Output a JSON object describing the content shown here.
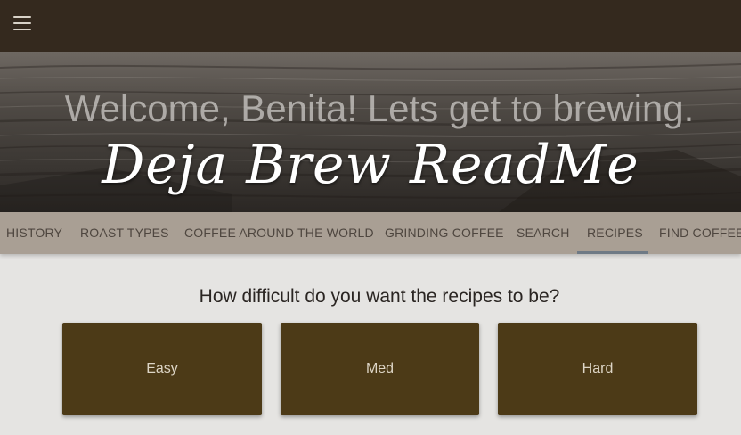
{
  "header": {
    "menu_icon": "hamburger-menu-icon"
  },
  "hero": {
    "welcome": "Welcome, Benita! Lets get to brewing.",
    "brand": "Deja Brew ReadMe"
  },
  "tabs": [
    {
      "label": "HISTORY"
    },
    {
      "label": "ROAST TYPES"
    },
    {
      "label": "COFFEE AROUND THE WORLD"
    },
    {
      "label": "GRINDING COFFEE"
    },
    {
      "label": "SEARCH"
    },
    {
      "label": "RECIPES"
    },
    {
      "label": "FIND COFFEE"
    }
  ],
  "active_tab": "RECIPES",
  "recipes": {
    "question": "How difficult do you want the recipes to be?",
    "options": [
      {
        "label": "Easy"
      },
      {
        "label": "Med"
      },
      {
        "label": "Hard"
      }
    ]
  },
  "colors": {
    "topbar": "#34291e",
    "tab_bar": "#a99f94",
    "card": "#4c3a17",
    "background": "#e5e4e2"
  }
}
